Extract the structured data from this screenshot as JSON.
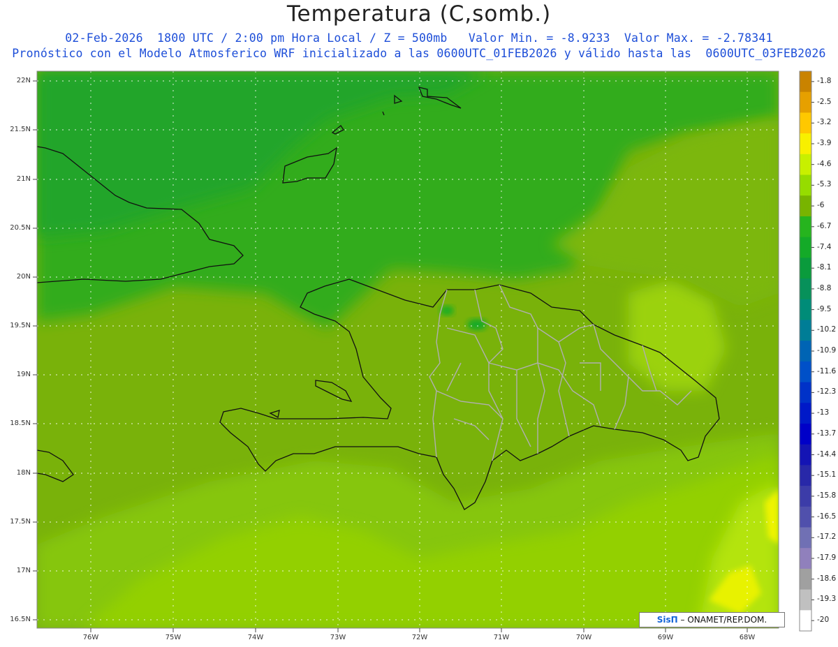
{
  "header": {
    "title": "Temperatura (C,somb.)",
    "subtitle_line1": "02-Feb-2026  1800 UTC / 2:00 pm Hora Local / Z = 500mb   Valor Min. = -8.9233  Valor Max. = -2.78341",
    "subtitle_line2": "Pronóstico con el Modelo Atmosferico WRF inicializado a las 0600UTC_01FEB2026 y válido hasta las  0600UTC_03FEB2026"
  },
  "map": {
    "latitude_labels": [
      "22N",
      "21.5N",
      "21N",
      "20.5N",
      "20N",
      "19.5N",
      "19N",
      "18.5N",
      "18N",
      "17.5N",
      "17N",
      "16.5N"
    ],
    "longitude_labels": [
      "76W",
      "75W",
      "74W",
      "73W",
      "72W",
      "71W",
      "70W",
      "69W",
      "68W"
    ],
    "region": "Hispaniola (Haiti / República Dominicana)"
  },
  "colorbar": {
    "labels": [
      "-1.8",
      "-2.5",
      "-3.2",
      "-3.9",
      "-4.6",
      "-5.3",
      "-6",
      "-6.7",
      "-7.4",
      "-8.1",
      "-8.8",
      "-9.5",
      "-10.2",
      "-10.9",
      "-11.6",
      "-12.3",
      "-13",
      "-13.7",
      "-14.4",
      "-15.1",
      "-15.8",
      "-16.5",
      "-17.2",
      "-17.9",
      "-18.6",
      "-19.3",
      "-20"
    ],
    "colors": [
      "#c98300",
      "#e6a000",
      "#ffc800",
      "#f8f000",
      "#c8f000",
      "#96dc00",
      "#78b400",
      "#26b41e",
      "#14aa28",
      "#0a9b3c",
      "#07915a",
      "#008c78",
      "#007d96",
      "#0064b4",
      "#0050c8",
      "#0032c8",
      "#0019c8",
      "#0000c8",
      "#1414b4",
      "#2828a8",
      "#3c3ca8",
      "#5050ac",
      "#7070b4",
      "#9080bc",
      "#a0a0a0",
      "#c0c0c0",
      "#ffffff"
    ]
  },
  "credit": {
    "brand": "SisΠ",
    "text": " – ONAMET/REP.DOM."
  }
}
